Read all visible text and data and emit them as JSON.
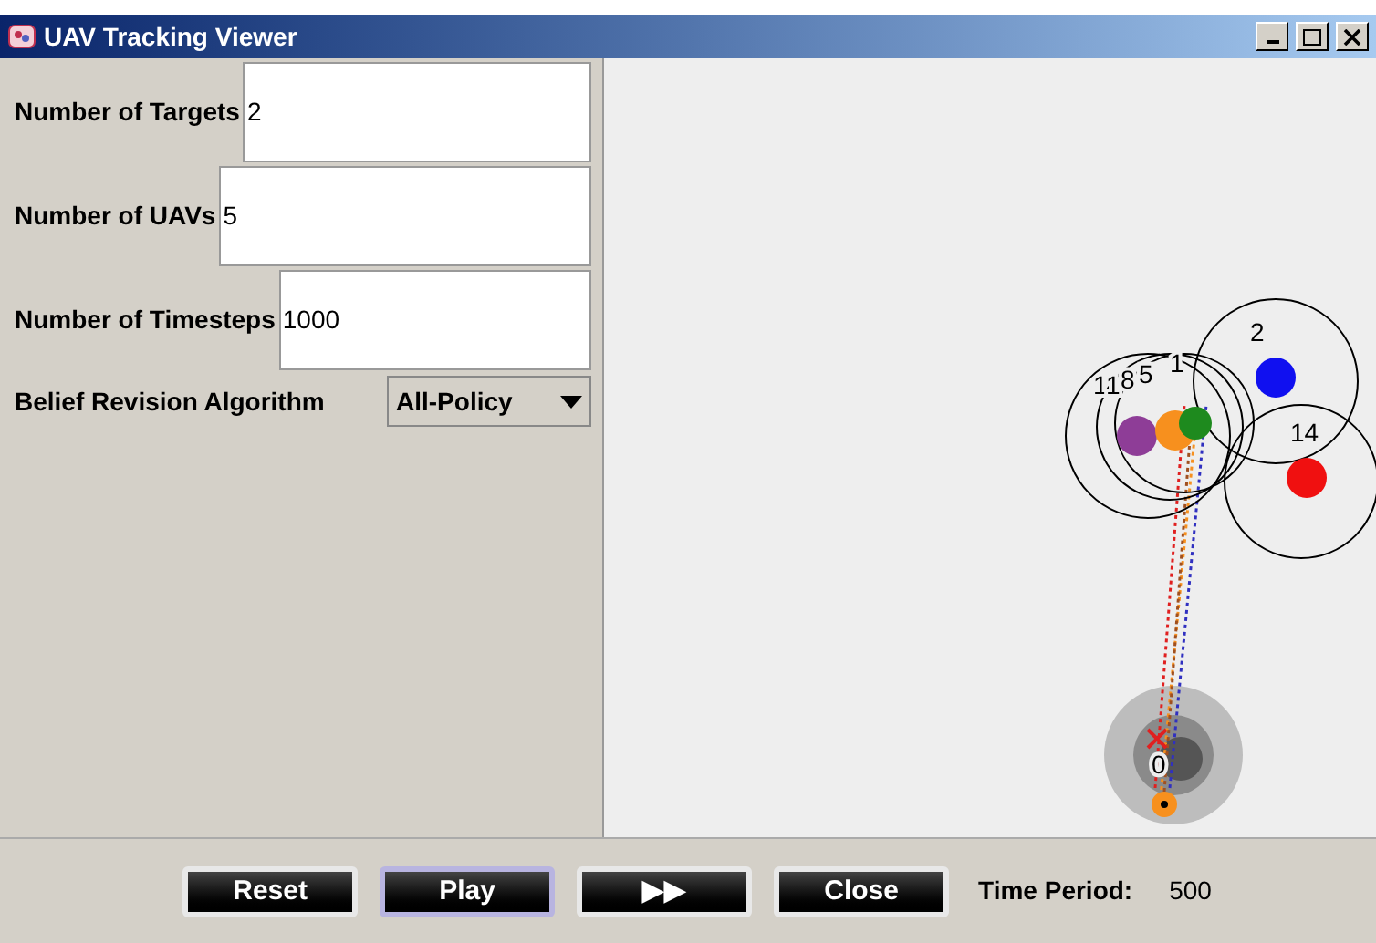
{
  "window": {
    "title": "UAV Tracking Viewer"
  },
  "fields": [
    {
      "label": "Number of Targets",
      "value": "2"
    },
    {
      "label": "Number of UAVs",
      "value": "5"
    },
    {
      "label": "Number of Timesteps",
      "value": "1000"
    }
  ],
  "algorithm": {
    "label": "Belief Revision Algorithm",
    "value": "All-Policy"
  },
  "canvas": {
    "labels": [
      "1",
      "1",
      "8",
      "5",
      "1",
      "2",
      "14",
      "0"
    ],
    "markers": [
      {
        "color": "#8e3d97"
      },
      {
        "color": "#f7901e"
      },
      {
        "color": "#1e8a1e"
      },
      {
        "color": "#1010f0"
      },
      {
        "color": "#f01010"
      }
    ]
  },
  "buttons": [
    {
      "label": "Reset",
      "focused": false
    },
    {
      "label": "Play",
      "focused": true
    },
    {
      "label": "▶▶",
      "focused": false
    },
    {
      "label": "Close",
      "focused": false
    }
  ],
  "status": {
    "label": "Time Period:",
    "value": "500"
  }
}
